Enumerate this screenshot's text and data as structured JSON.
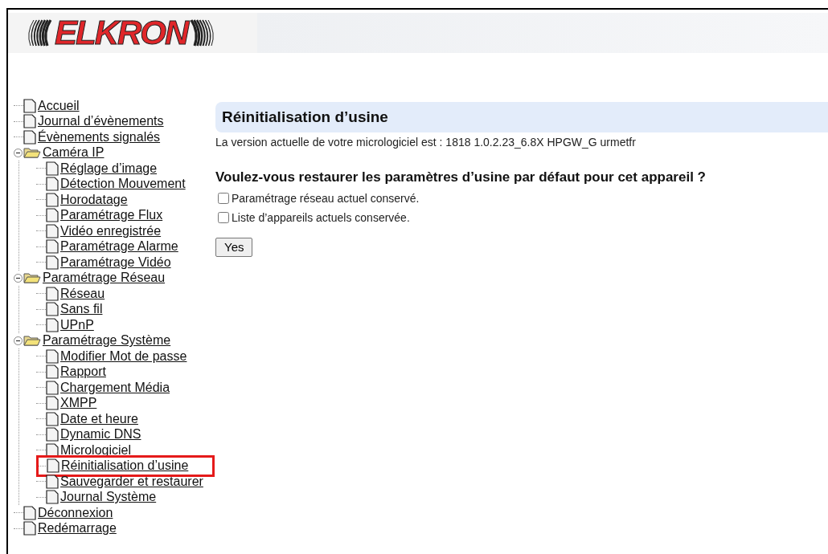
{
  "logo": {
    "text": "ELKRON"
  },
  "nav": [
    {
      "kind": "page",
      "label": "Accueil",
      "highlighted": false
    },
    {
      "kind": "page",
      "label": "Journal d’évènements",
      "highlighted": false
    },
    {
      "kind": "page",
      "label": "Évènements signalés",
      "highlighted": false
    },
    {
      "kind": "folder",
      "label": "Caméra IP",
      "expanded": true,
      "children": [
        {
          "kind": "page",
          "label": "Réglage d’image",
          "highlighted": false
        },
        {
          "kind": "page",
          "label": "Détection Mouvement",
          "highlighted": false
        },
        {
          "kind": "page",
          "label": "Horodatage",
          "highlighted": false
        },
        {
          "kind": "page",
          "label": "Paramétrage Flux",
          "highlighted": false
        },
        {
          "kind": "page",
          "label": "Vidéo enregistrée",
          "highlighted": false
        },
        {
          "kind": "page",
          "label": "Paramétrage Alarme",
          "highlighted": false
        },
        {
          "kind": "page",
          "label": "Paramétrage Vidéo",
          "highlighted": false
        }
      ]
    },
    {
      "kind": "folder",
      "label": "Paramétrage Réseau",
      "expanded": true,
      "children": [
        {
          "kind": "page",
          "label": "Réseau",
          "highlighted": false
        },
        {
          "kind": "page",
          "label": "Sans fil",
          "highlighted": false
        },
        {
          "kind": "page",
          "label": "UPnP",
          "highlighted": false
        }
      ]
    },
    {
      "kind": "folder",
      "label": "Paramétrage Système",
      "expanded": true,
      "children": [
        {
          "kind": "page",
          "label": "Modifier Mot de passe",
          "highlighted": false
        },
        {
          "kind": "page",
          "label": "Rapport",
          "highlighted": false
        },
        {
          "kind": "page",
          "label": "Chargement Média",
          "highlighted": false
        },
        {
          "kind": "page",
          "label": "XMPP",
          "highlighted": false
        },
        {
          "kind": "page",
          "label": "Date et heure",
          "highlighted": false
        },
        {
          "kind": "page",
          "label": "Dynamic DNS",
          "highlighted": false
        },
        {
          "kind": "page",
          "label": "Micrologiciel",
          "highlighted": false
        },
        {
          "kind": "page",
          "label": "Réinitialisation d’usine",
          "highlighted": true
        },
        {
          "kind": "page",
          "label": "Sauvegarder et restaurer",
          "highlighted": false
        },
        {
          "kind": "page",
          "label": "Journal Système",
          "highlighted": false
        }
      ]
    },
    {
      "kind": "page",
      "label": "Déconnexion",
      "highlighted": false
    },
    {
      "kind": "page",
      "label": "Redémarrage",
      "highlighted": false
    }
  ],
  "content": {
    "title": "Réinitialisation d’usine",
    "version_text": "La version actuelle de votre micrologiciel est : 1818 1.0.2.23_6.8X HPGW_G urmetfr",
    "question": "Voulez-vous restaurer les paramètres d’usine par défaut pour cet appareil ?",
    "options": [
      {
        "label": "Paramétrage réseau actuel conservé.",
        "checked": false
      },
      {
        "label": "Liste d’appareils actuels conservée.",
        "checked": false
      }
    ],
    "button": "Yes"
  }
}
